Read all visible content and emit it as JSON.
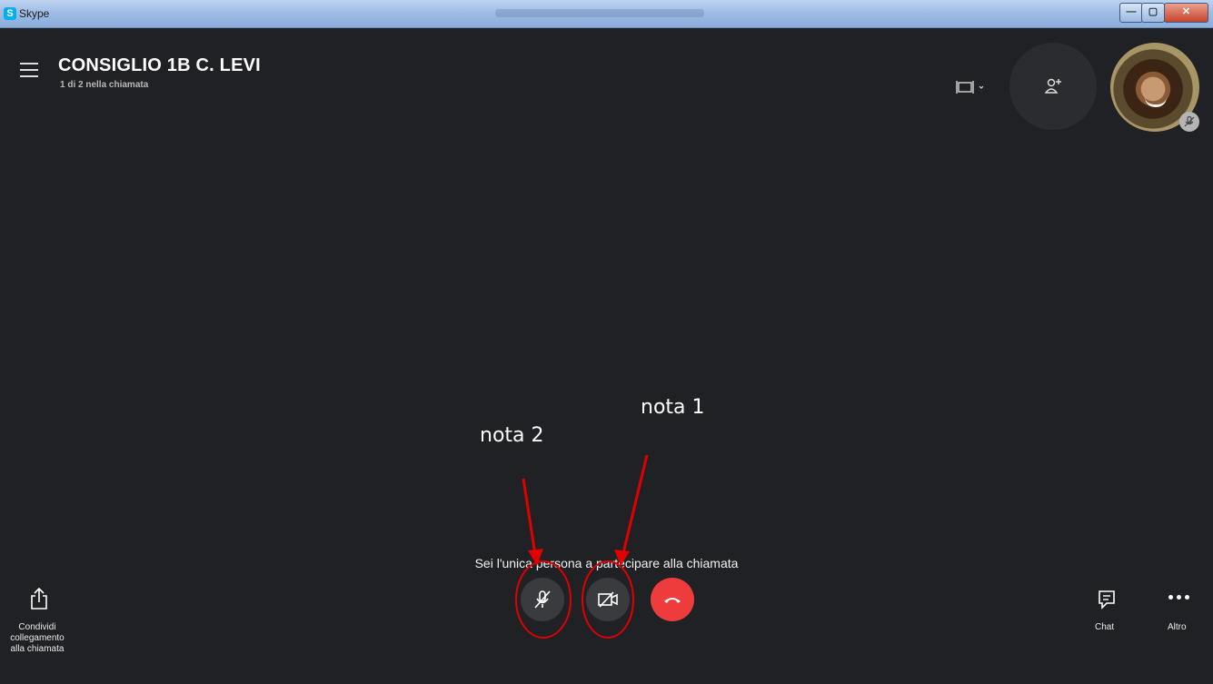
{
  "window": {
    "app_name": "Skype",
    "app_icon_letter": "S",
    "minimize_glyph": "—",
    "maximize_glyph": "▢",
    "close_glyph": "✕"
  },
  "call": {
    "title": "CONSIGLIO 1B C. LEVI",
    "subtitle": "1 di 2 nella chiamata",
    "status": "Sei l'unica persona a partecipare alla chiamata"
  },
  "toolbar": {
    "share_label": "Condividi collegamento alla chiamata",
    "chat_label": "Chat",
    "more_label": "Altro"
  },
  "annotations": {
    "note1": "nota 1",
    "note2": "nota 2",
    "color": "#e00000"
  },
  "icons": [
    "menu-icon",
    "layout-icon",
    "add-person-icon",
    "mute-icon",
    "video-off-icon",
    "hangup-icon",
    "share-icon",
    "chat-icon",
    "more-icon"
  ],
  "colors": {
    "background": "#202124",
    "hangup": "#ee3b3b",
    "control": "#3a3b3f"
  }
}
